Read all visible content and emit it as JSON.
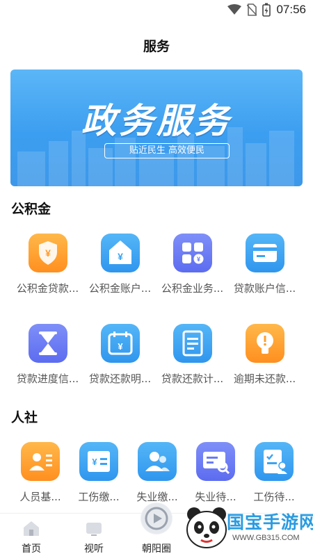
{
  "status_bar": {
    "time": "07:56",
    "icons": [
      "wifi-icon",
      "no-sim-icon",
      "battery-charging-icon"
    ]
  },
  "page": {
    "title": "服务"
  },
  "banner": {
    "title": "政务服务",
    "subtitle": "贴近民生 高效便民"
  },
  "sections": [
    {
      "title": "公积金",
      "items": [
        {
          "label": "公积金贷款...",
          "icon": "shield-yen-icon",
          "color": "#ff9f2a"
        },
        {
          "label": "公积金账户...",
          "icon": "house-yen-icon",
          "color": "#3ba4f3"
        },
        {
          "label": "公积金业务...",
          "icon": "grid-apps-icon",
          "color": "#6a7cf5"
        },
        {
          "label": "贷款账户信...",
          "icon": "card-icon",
          "color": "#3ba4f3"
        },
        {
          "label": "贷款进度信...",
          "icon": "hourglass-icon",
          "color": "#6a7cf5"
        },
        {
          "label": "贷款还款明...",
          "icon": "calendar-yen-icon",
          "color": "#3ba4f3"
        },
        {
          "label": "贷款还款计...",
          "icon": "document-list-icon",
          "color": "#3ba4f3"
        },
        {
          "label": "逾期未还款...",
          "icon": "lightbulb-icon",
          "color": "#ff9f2a"
        }
      ]
    },
    {
      "title": "人社",
      "items": [
        {
          "label": "人员基...",
          "icon": "person-card-icon",
          "color": "#ff9f2a"
        },
        {
          "label": "工伤缴...",
          "icon": "receipt-yen-icon",
          "color": "#3ba4f3"
        },
        {
          "label": "失业缴...",
          "icon": "people-icon",
          "color": "#3ba4f3"
        },
        {
          "label": "失业待...",
          "icon": "search-card-icon",
          "color": "#6a7cf5"
        },
        {
          "label": "工伤待...",
          "icon": "checklist-person-icon",
          "color": "#3ba4f3"
        }
      ]
    }
  ],
  "tabbar": [
    {
      "label": "首页",
      "icon": "home-icon"
    },
    {
      "label": "视听",
      "icon": "tv-icon"
    },
    {
      "label": "朝阳圈",
      "icon": "play-circle-icon"
    }
  ],
  "watermark": {
    "text": "国宝手游网",
    "url": "WWW.GB315.COM"
  }
}
